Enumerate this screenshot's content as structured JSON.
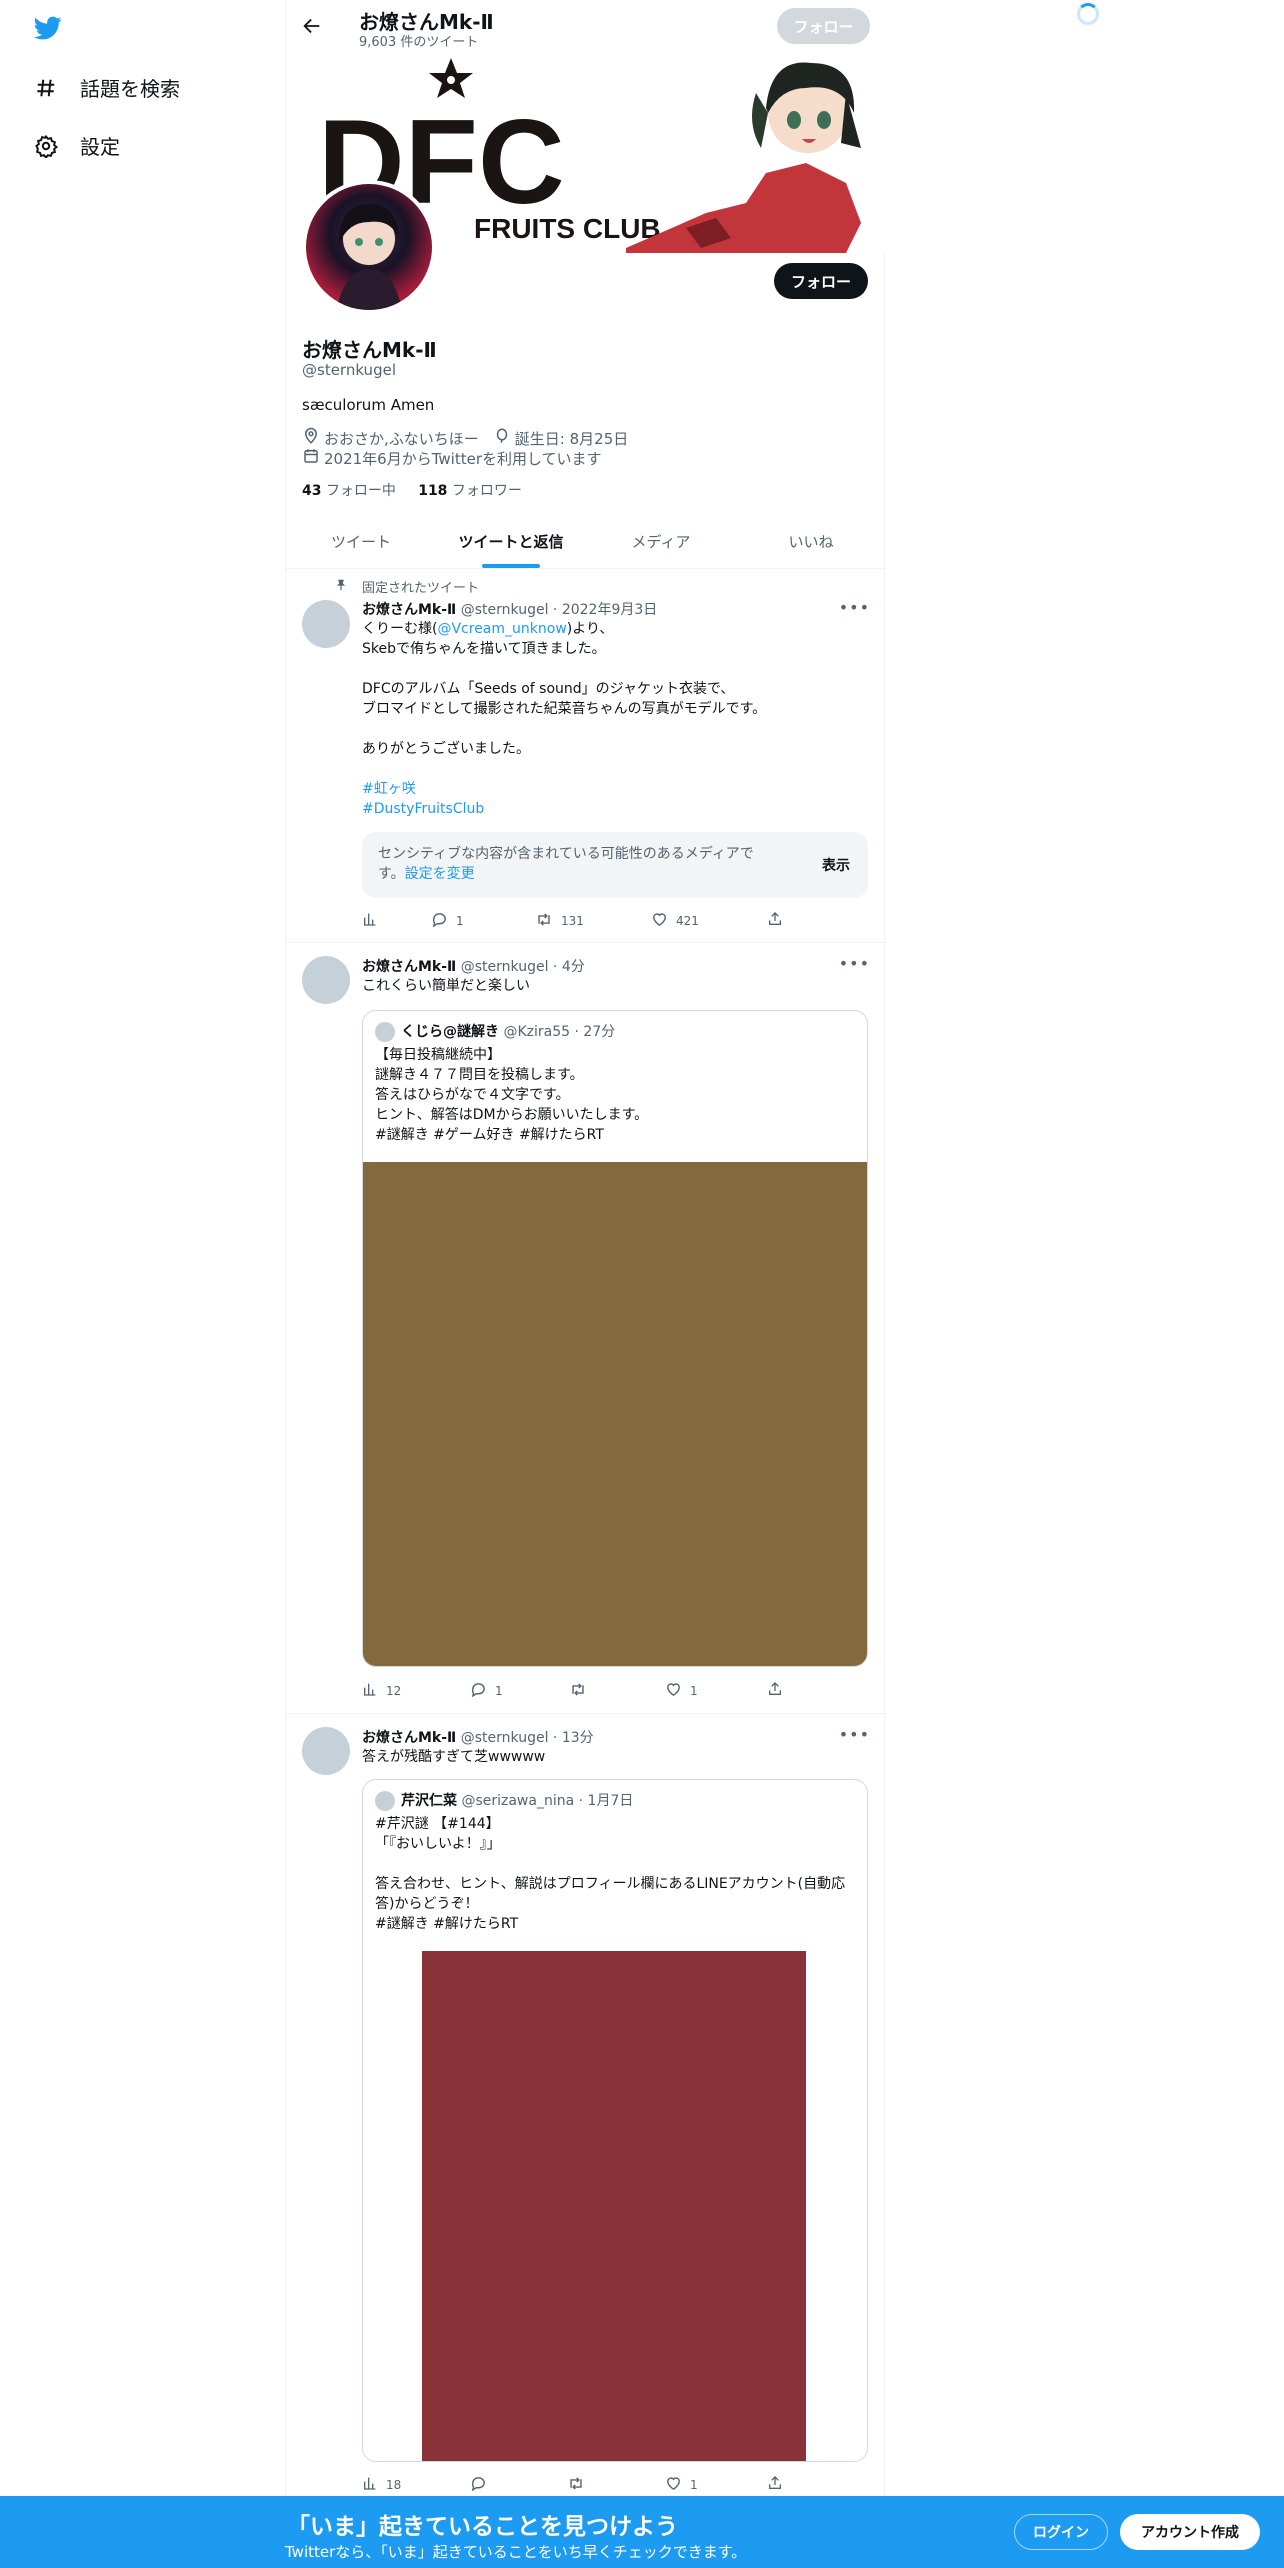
{
  "sidebar": {
    "items": [
      {
        "label": "話題を検索",
        "icon": "hashtag-icon"
      },
      {
        "label": "設定",
        "icon": "gear-icon"
      }
    ]
  },
  "topbar": {
    "title": "お燎さんMk-Ⅱ",
    "tweet_count": "9,603 件のツイート",
    "follow_label": "フォロー"
  },
  "banner": {
    "logo_text": "DFC",
    "logo_sub": "FRUITS CLUB"
  },
  "profile": {
    "name": "お燎さんMk-Ⅱ",
    "handle": "@sternkugel",
    "bio": "sæculorum Amen",
    "location": "おおさか,ふないちほー",
    "birthday": "誕生日: 8月25日",
    "joined": "2021年6月からTwitterを利用しています",
    "following_count": "43",
    "following_label": "フォロー中",
    "followers_count": "118",
    "followers_label": "フォロワー",
    "follow_label": "フォロー"
  },
  "tabs": [
    {
      "label": "ツイート",
      "active": false
    },
    {
      "label": "ツイートと返信",
      "active": true
    },
    {
      "label": "メディア",
      "active": false
    },
    {
      "label": "いいね",
      "active": false
    }
  ],
  "tweets": [
    {
      "pinned_label": "固定されたツイート",
      "name": "お燎さんMk-Ⅱ",
      "handle": "@sternkugel",
      "time": "2022年9月3日",
      "text_1": "くりーむ様(",
      "mention": "@Vcream_unknow",
      "text_2": ")より、\nSkebで侑ちゃんを描いて頂きました。\n\nDFCのアルバム「Seeds of sound」のジャケット衣装で、\nブロマイドとして撮影された紀菜音ちゃんの写真がモデルです。\n\nありがとうございました。",
      "hashtag_1": "#虹ヶ咲",
      "hashtag_2": "#DustyFruitsClub",
      "sensitive_text": "センシティブな内容が含まれている可能性のあるメディアです。",
      "sensitive_link": "設定を変更",
      "sensitive_button": "表示",
      "replies": "1",
      "retweets": "131",
      "likes": "421"
    },
    {
      "name": "お燎さんMk-Ⅱ",
      "handle": "@sternkugel",
      "time": "4分",
      "text": "これくらい簡単だと楽しい",
      "quote": {
        "name": "くじら@謎解き",
        "handle": "@Kzira55",
        "time": "27分",
        "text": "【毎日投稿継続中】\n謎解き４７７問目を投稿します。\n答えはひらがなで４文字です。\nヒント、解答はDMからお願いいたします。\n#謎解き #ゲーム好き #解けたらRT",
        "media_color": "#83693d"
      },
      "views": "12",
      "replies": "1",
      "retweets": "",
      "likes": "1"
    },
    {
      "name": "お燎さんMk-Ⅱ",
      "handle": "@sternkugel",
      "time": "13分",
      "text": "答えが残酷すぎて芝wwwww",
      "quote": {
        "name": "芹沢仁菜",
        "handle": "@serizawa_nina",
        "time": "1月7日",
        "text": "#芹沢謎 【#144】\n「『おいしいよ！』」\n\n答え合わせ、ヒント、解説はプロフィール欄にあるLINEアカウント(自動応答)からどうぞ！\n#謎解き #解けたらRT",
        "media_color": "#893237"
      },
      "views": "18",
      "replies": "",
      "retweets": "",
      "likes": "1"
    }
  ],
  "bottom_bar": {
    "title": "「いま」起きていることを見つけよう",
    "subtitle": "Twitterなら、「いま」起きていることをいち早くチェックできます。",
    "login_label": "ログイン",
    "signup_label": "アカウント作成"
  },
  "colors": {
    "accent": "#1d9bf0",
    "text": "#0f1419",
    "muted": "#536471"
  }
}
